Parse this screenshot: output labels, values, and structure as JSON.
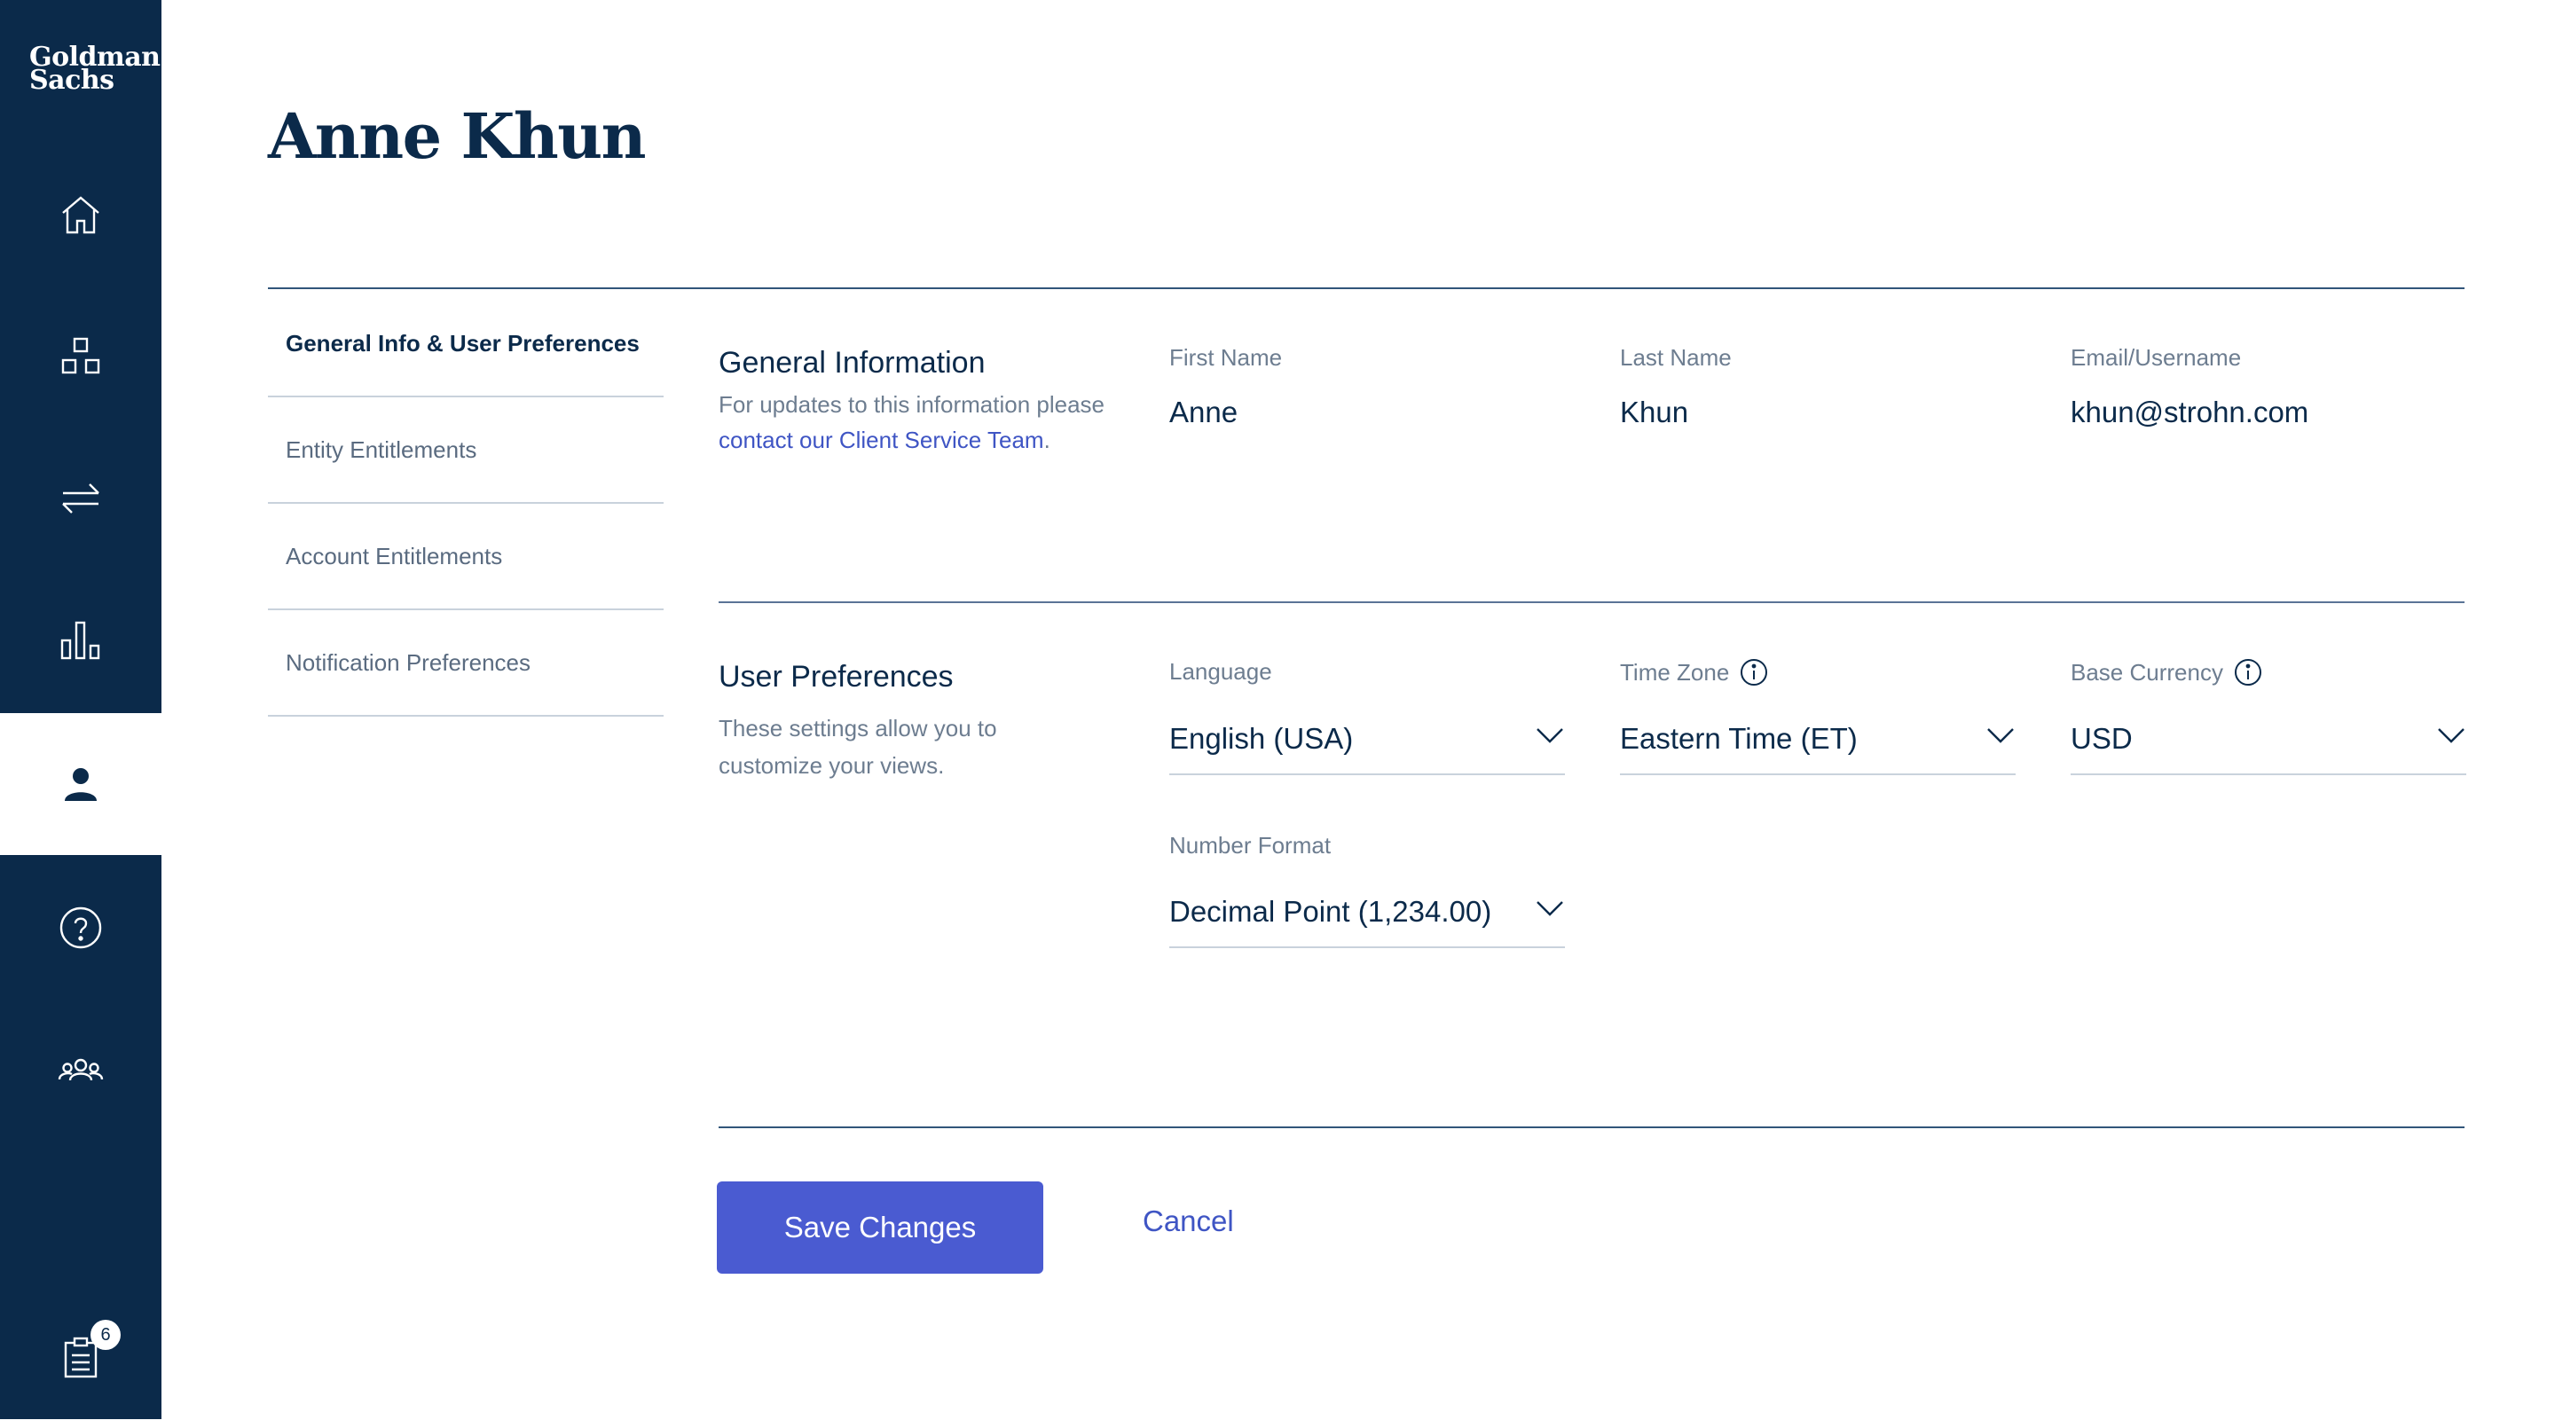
{
  "brand": {
    "logo_line1": "Goldman",
    "logo_line2": "Sachs"
  },
  "sidebar": {
    "items": [
      {
        "icon": "home-icon"
      },
      {
        "icon": "dashboard-icon"
      },
      {
        "icon": "transfer-icon"
      },
      {
        "icon": "bar-chart-icon"
      },
      {
        "icon": "user-icon",
        "active": true
      },
      {
        "icon": "help-icon"
      },
      {
        "icon": "team-icon"
      },
      {
        "icon": "clipboard-icon",
        "badge": "6"
      }
    ]
  },
  "page": {
    "title": "Anne Khun"
  },
  "tabs": [
    {
      "label": "General Info & User Preferences",
      "active": true
    },
    {
      "label": "Entity Entitlements"
    },
    {
      "label": "Account Entitlements"
    },
    {
      "label": "Notification Preferences"
    }
  ],
  "general": {
    "title": "General Information",
    "desc_prefix": "For updates to this information please ",
    "desc_link": "contact our Client Service Team",
    "desc_suffix": ".",
    "first_name_label": "First Name",
    "first_name": "Anne",
    "last_name_label": "Last Name",
    "last_name": "Khun",
    "email_label": "Email/Username",
    "email": "khun@strohn.com"
  },
  "preferences": {
    "title": "User Preferences",
    "desc": "These settings allow you to customize your views.",
    "language_label": "Language",
    "language": "English (USA)",
    "timezone_label": "Time Zone",
    "timezone": "Eastern Time (ET)",
    "currency_label": "Base Currency",
    "currency": "USD",
    "number_format_label": "Number Format",
    "number_format": "Decimal Point (1,234.00)"
  },
  "actions": {
    "save": "Save Changes",
    "cancel": "Cancel"
  },
  "colors": {
    "navy": "#0b2a4a",
    "accent": "#4a5bd1",
    "link": "#3f55c4"
  }
}
